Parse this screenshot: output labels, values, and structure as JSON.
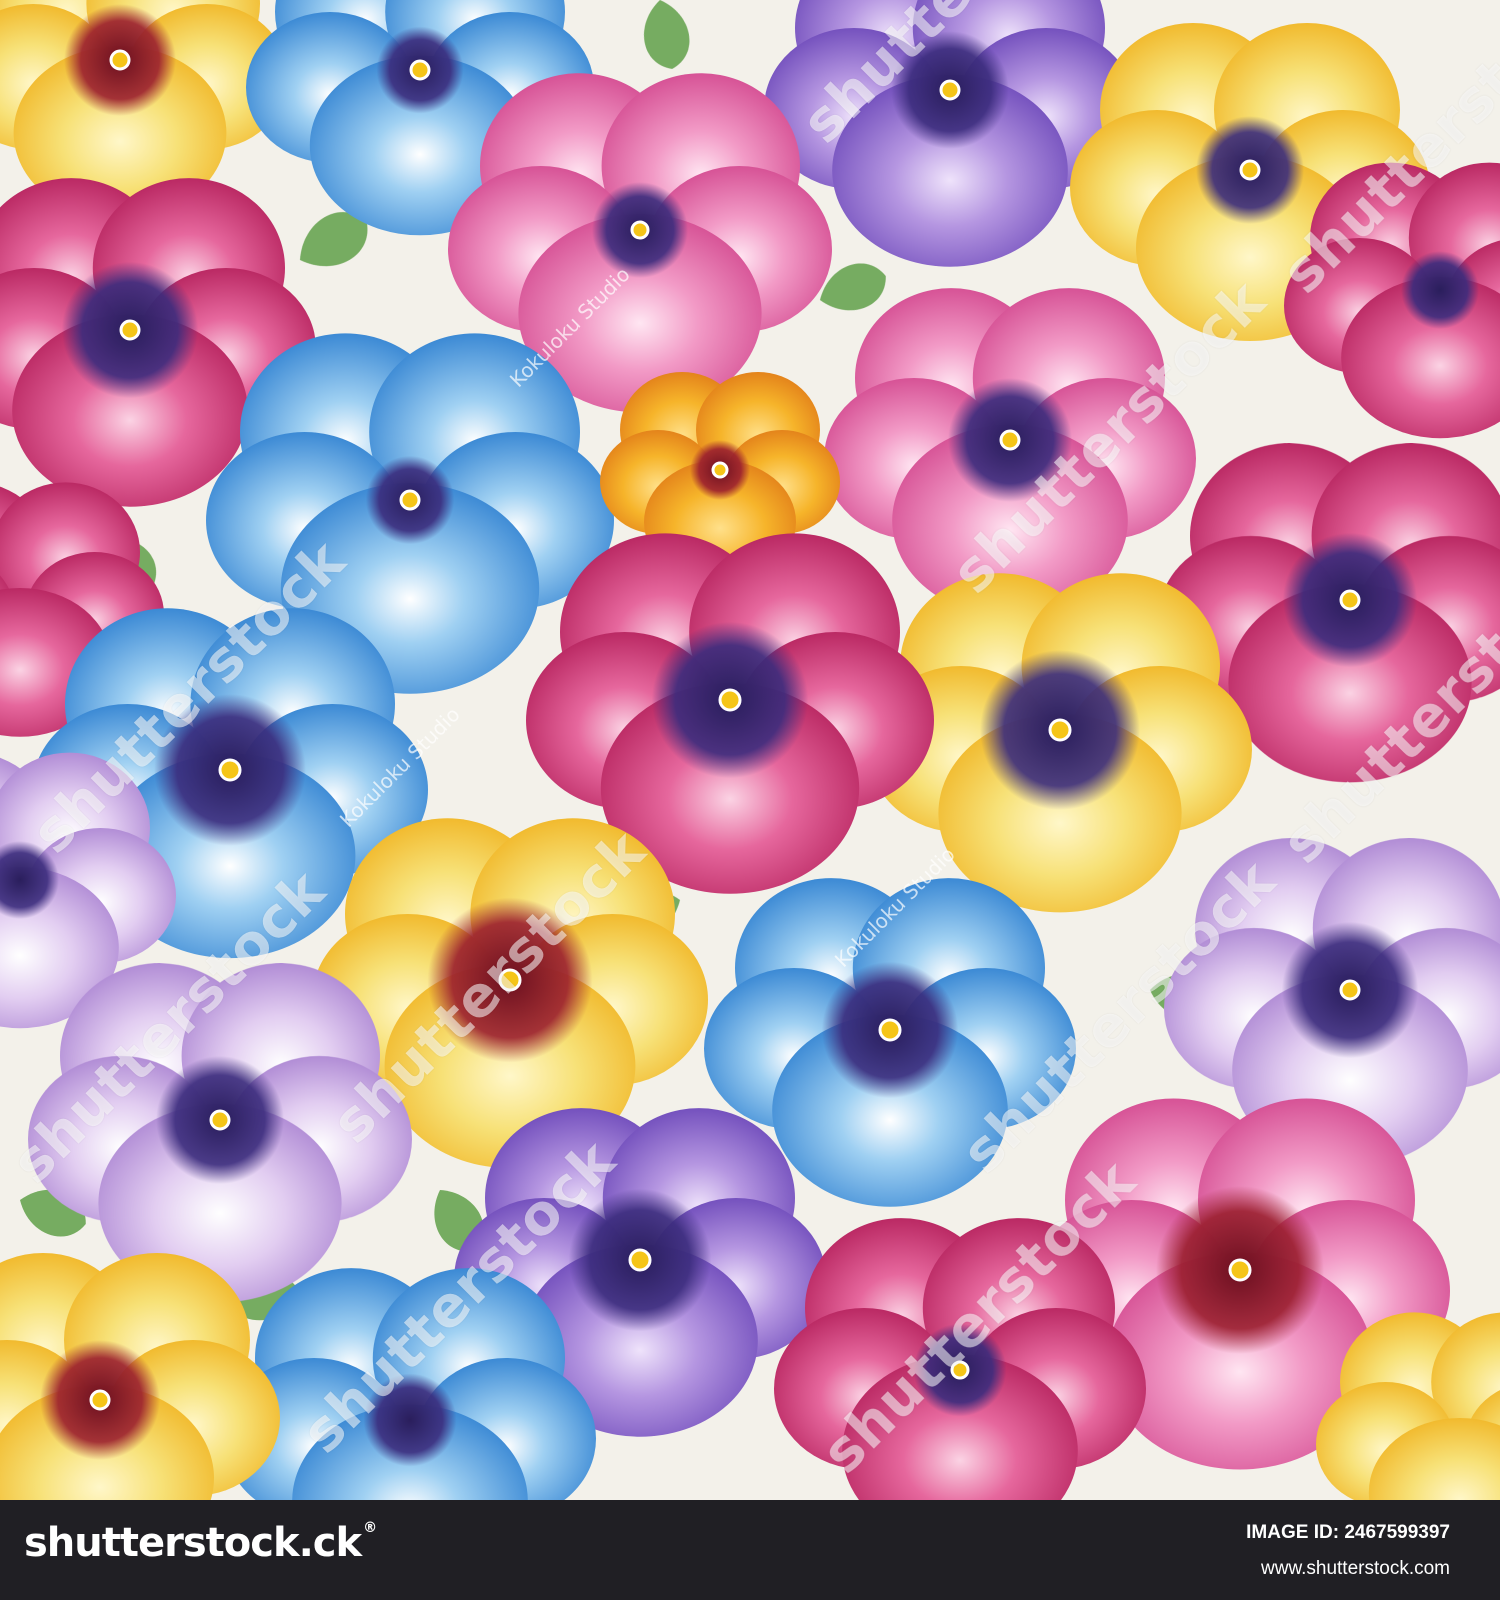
{
  "image": {
    "description_subject": "watercolor-pansy-pattern",
    "flower_colors": [
      "#3f8fd8",
      "#d9468c",
      "#f2c23a",
      "#8a5fc7",
      "#f08bc0",
      "#e0497a"
    ],
    "leaf_color": "#6fa85a",
    "background_color": "#f3f1ea"
  },
  "watermark": {
    "brand": "shutterstock",
    "artist": "Kokuloku Studio"
  },
  "footer": {
    "logo_text": "shutterstock",
    "logo_mark": ".ck",
    "registered": "®",
    "image_id_label": "IMAGE ID:",
    "image_id": "2467599397",
    "site_url": "www.shutterstock.com",
    "background_color": "#201f24"
  }
}
